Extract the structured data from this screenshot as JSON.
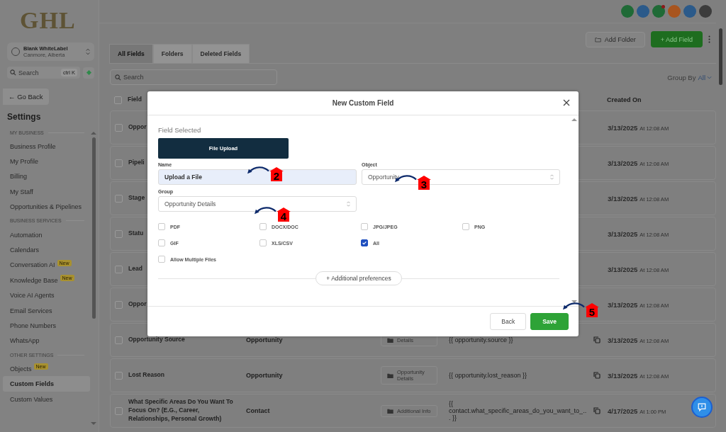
{
  "sidebar": {
    "logo": "GHL",
    "account": {
      "name": "Blank WhiteLabel",
      "location": "Canmore, Alberta"
    },
    "search": {
      "placeholder": "Search",
      "shortcut": "ctrl K"
    },
    "back_button": "← Go Back",
    "title": "Settings",
    "sections": [
      {
        "heading": "MY BUSINESS",
        "items": [
          {
            "label": "Business Profile",
            "selected": false
          },
          {
            "label": "My Profile",
            "selected": false
          },
          {
            "label": "Billing",
            "selected": false
          },
          {
            "label": "My Staff",
            "selected": false
          },
          {
            "label": "Opportunities & Pipelines",
            "selected": false
          }
        ]
      },
      {
        "heading": "BUSINESS SERVICES",
        "items": [
          {
            "label": "Automation",
            "selected": false
          },
          {
            "label": "Calendars",
            "selected": false
          },
          {
            "label": "Conversation AI",
            "selected": false,
            "badge": "New"
          },
          {
            "label": "Knowledge Base",
            "selected": false,
            "badge": "New"
          },
          {
            "label": "Voice AI Agents",
            "selected": false
          },
          {
            "label": "Email Services",
            "selected": false
          },
          {
            "label": "Phone Numbers",
            "selected": false
          },
          {
            "label": "WhatsApp",
            "selected": false
          }
        ]
      },
      {
        "heading": "OTHER SETTINGS",
        "items": [
          {
            "label": "Objects",
            "selected": false,
            "badge": "New"
          },
          {
            "label": "Custom Fields",
            "selected": true
          },
          {
            "label": "Custom Values",
            "selected": false
          }
        ]
      }
    ]
  },
  "toolbar": {
    "add_folder": "Add Folder",
    "add_field": "+ Add Field"
  },
  "tabs": [
    {
      "label": "All Fields",
      "selected": true
    },
    {
      "label": "Folders",
      "selected": false
    },
    {
      "label": "Deleted Fields",
      "selected": false
    }
  ],
  "search": {
    "placeholder": "Search"
  },
  "group_by": {
    "label": "Group By",
    "value": "All"
  },
  "table": {
    "columns": {
      "field": "Field",
      "created_on": "Created On"
    },
    "select_all": {
      "checked": false
    },
    "rows": [
      {
        "checked": false,
        "field": "Oppor",
        "date": "3/13/2025",
        "time": "At 12:08 AM"
      },
      {
        "checked": false,
        "field": "Pipeli",
        "date": "3/13/2025",
        "time": "At 12:08 AM"
      },
      {
        "checked": false,
        "field": "Stage",
        "date": "3/13/2025",
        "time": "At 12:08 AM"
      },
      {
        "checked": false,
        "field": "Statu",
        "date": "3/13/2025",
        "time": "At 12:08 AM"
      },
      {
        "checked": false,
        "field": "Lead",
        "date": "3/13/2025",
        "time": "At 12:08 AM"
      },
      {
        "checked": false,
        "field": "Oppor",
        "date": "3/13/2025",
        "time": "At 12:08 AM"
      },
      {
        "checked": false,
        "field": "Opportunity Source",
        "object": "Opportunity",
        "group": "Details",
        "key": "{{ opportunity.source }}",
        "date": "3/13/2025",
        "time": "At 12:08 AM"
      },
      {
        "checked": false,
        "field": "Lost Reason",
        "object": "Opportunity",
        "group": "Opportunity Details",
        "key": "{{ opportunity.lost_reason }}",
        "date": "3/13/2025",
        "time": "At 12:08 AM"
      },
      {
        "checked": false,
        "field": "What Specific Areas Do You Want To Focus On? (E.G., Career, Relationships, Personal Growth)",
        "object": "Contact",
        "group": "Additional Info",
        "key": "{{ contact.what_specific_areas_do_you_want_to_... }}",
        "date": "4/17/2025",
        "time": "At 1:00 PM"
      }
    ]
  },
  "modal": {
    "title": "New Custom Field",
    "field_selected_label": "Field Selected",
    "field_type": "File Upload",
    "name": {
      "label": "Name",
      "value": "Upload a File"
    },
    "object": {
      "label": "Object",
      "value": "Opportunity"
    },
    "group": {
      "label": "Group",
      "value": "Opportunity Details"
    },
    "file_types": [
      {
        "label": "PDF",
        "checked": false
      },
      {
        "label": "DOCX/DOC",
        "checked": false
      },
      {
        "label": "JPG/JPEG",
        "checked": false
      },
      {
        "label": "PNG",
        "checked": false
      },
      {
        "label": "GIF",
        "checked": false
      },
      {
        "label": "XLS/CSV",
        "checked": false
      },
      {
        "label": "All",
        "checked": true
      }
    ],
    "allow_multiple": {
      "label": "Allow Multiple Files",
      "checked": false
    },
    "additional_button": "+ Additional preferences",
    "buttons": [
      {
        "label": "Back",
        "kind": "secondary"
      },
      {
        "label": "Save",
        "kind": "primary"
      }
    ]
  },
  "annotations": [
    {
      "label": "2"
    },
    {
      "label": "3"
    },
    {
      "label": "4"
    },
    {
      "label": "5"
    }
  ]
}
